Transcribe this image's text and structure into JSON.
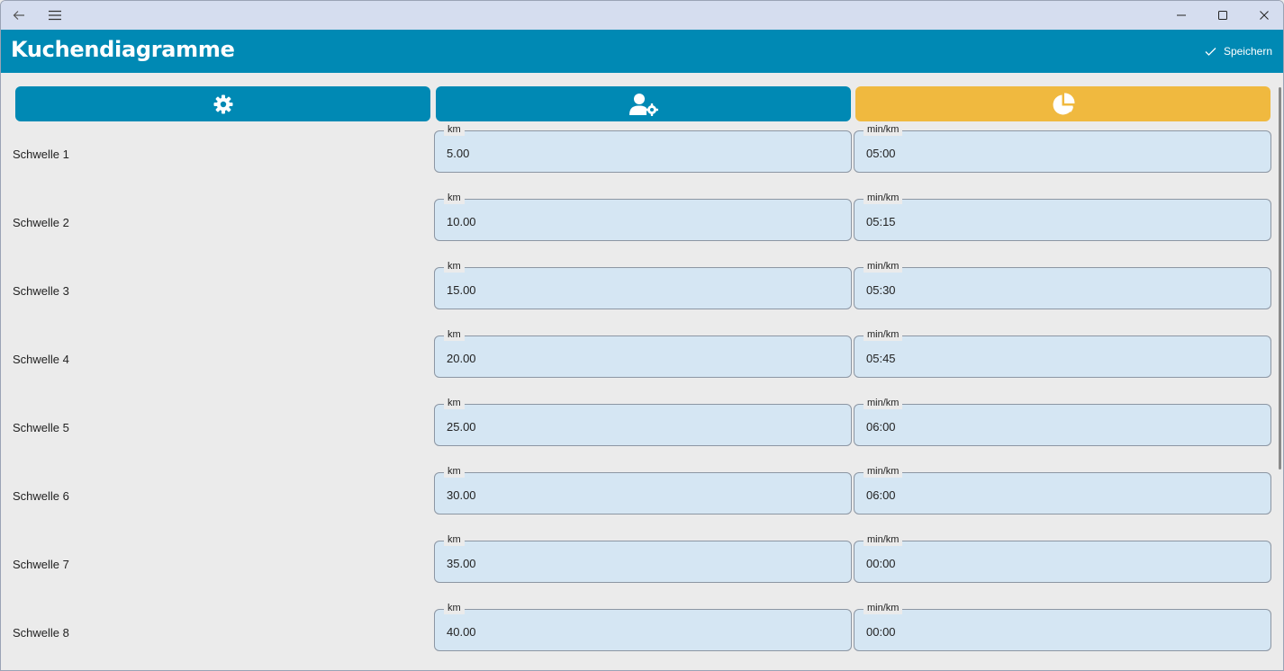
{
  "header": {
    "title": "Kuchendiagramme",
    "save_label": "Speichern"
  },
  "tabs": [
    {
      "icon": "gear-icon",
      "active": false
    },
    {
      "icon": "user-settings-icon",
      "active": false
    },
    {
      "icon": "pie-chart-icon",
      "active": true
    }
  ],
  "colors": {
    "header": "#0089b4",
    "tab": "#0089b4",
    "tab_active": "#f0b93f",
    "field_bg": "#d5e6f3",
    "background": "#ebebeb"
  },
  "rows": [
    {
      "label": "Schwelle 1",
      "km_label": "km",
      "km": "5.00",
      "pace_label": "min/km",
      "pace": "05:00"
    },
    {
      "label": "Schwelle 2",
      "km_label": "km",
      "km": "10.00",
      "pace_label": "min/km",
      "pace": "05:15"
    },
    {
      "label": "Schwelle 3",
      "km_label": "km",
      "km": "15.00",
      "pace_label": "min/km",
      "pace": "05:30"
    },
    {
      "label": "Schwelle 4",
      "km_label": "km",
      "km": "20.00",
      "pace_label": "min/km",
      "pace": "05:45"
    },
    {
      "label": "Schwelle 5",
      "km_label": "km",
      "km": "25.00",
      "pace_label": "min/km",
      "pace": "06:00"
    },
    {
      "label": "Schwelle 6",
      "km_label": "km",
      "km": "30.00",
      "pace_label": "min/km",
      "pace": "06:00"
    },
    {
      "label": "Schwelle 7",
      "km_label": "km",
      "km": "35.00",
      "pace_label": "min/km",
      "pace": "00:00"
    },
    {
      "label": "Schwelle 8",
      "km_label": "km",
      "km": "40.00",
      "pace_label": "min/km",
      "pace": "00:00"
    }
  ]
}
